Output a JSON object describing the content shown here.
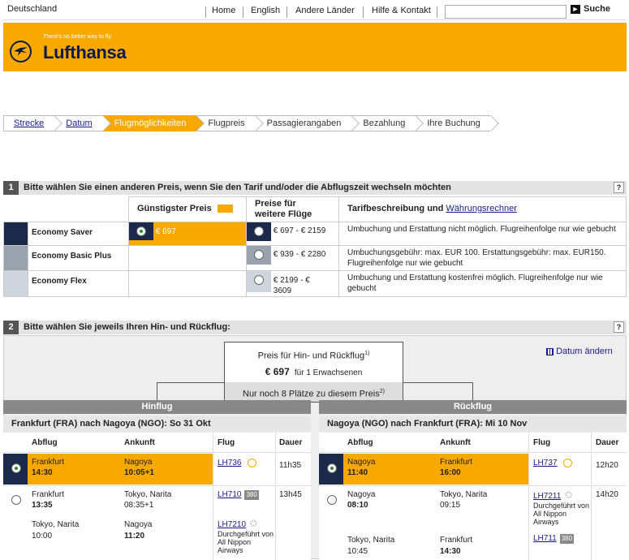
{
  "header": {
    "country": "Deutschland",
    "nav": [
      "Home",
      "English",
      "Andere Länder",
      "Hilfe & Kontakt"
    ],
    "search_label": "Suche",
    "search_value": ""
  },
  "banner": {
    "tagline": "There's no better way to fly.",
    "brand": "Lufthansa"
  },
  "breadcrumb": [
    {
      "label": "Strecke",
      "state": "link"
    },
    {
      "label": "Datum",
      "state": "link"
    },
    {
      "label": "Flugmöglichkeiten",
      "state": "active"
    },
    {
      "label": "Flugpreis",
      "state": "plain"
    },
    {
      "label": "Passagierangaben",
      "state": "plain"
    },
    {
      "label": "Bezahlung",
      "state": "plain"
    },
    {
      "label": "Ihre Buchung",
      "state": "plain"
    }
  ],
  "section1": {
    "number": "1",
    "title": "Bitte wählen Sie einen anderen Preis, wenn Sie den Tarif und/oder die Abflugszeit wechseln möchten",
    "help": "?",
    "col_cheapest": "Günstigster Preis",
    "col_other_line1": "Preise für",
    "col_other_line2": "weitere Flüge",
    "col_desc": "Tarifbeschreibung und",
    "col_desc_link": "Währungsrechner",
    "fares": [
      {
        "name": "Economy Saver",
        "swatch": "#1b2a4a",
        "cheapest": "€ 697",
        "other": "€ 697 - € 2159",
        "desc": "Umbuchung und Erstattung nicht möglich. Flugreihenfolge nur wie gebucht"
      },
      {
        "name": "Economy Basic Plus",
        "swatch": "#9aa3ad",
        "cheapest": "",
        "other": "€ 939 - € 2280",
        "desc": "Umbuchungsgebühr: max. EUR 100. Erstattungsgebühr: max. EUR150. Flugreihenfolge nur wie gebucht"
      },
      {
        "name": "Economy Flex",
        "swatch": "#cfd5dc",
        "cheapest": "",
        "other": "€ 2199 - € 3609",
        "desc": "Umbuchung und Erstattung kostenfrei möglich. Flugreihenfolge nur wie gebucht"
      }
    ]
  },
  "section2": {
    "number": "2",
    "title": "Bitte wählen Sie jeweils Ihren Hin- und Rückflug:",
    "help": "?",
    "price_box_title": "Preis für Hin- und Rückflug",
    "price_box_sup": "1)",
    "price": "€ 697",
    "price_for": "für 1 Erwachsenen",
    "seats_note": "Nur noch 8 Plätze zu diesem Preis",
    "seats_sup": "2)",
    "change_date": "Datum ändern",
    "outbound": {
      "label": "Hinflug",
      "route": "Frankfurt (FRA) nach Nagoya (NGO): So 31 Okt",
      "headers": [
        "Abflug",
        "Ankunft",
        "Flug",
        "Dauer"
      ],
      "options": [
        {
          "selected": true,
          "legs": [
            {
              "dep_city": "Frankfurt",
              "dep_time": "14:30",
              "arr_city": "Nagoya",
              "arr_time": "10:05+1",
              "flight": "LH736",
              "icon": "lufthansa-icon",
              "note": ""
            }
          ],
          "duration": "11h35"
        },
        {
          "selected": false,
          "legs": [
            {
              "dep_city": "Frankfurt",
              "dep_time": "13:35",
              "arr_city": "Tokyo, Narita",
              "arr_time": "08:35+1",
              "flight": "LH710",
              "icon": "aircraft-380-badge",
              "badge": "380",
              "note": ""
            },
            {
              "dep_city": "Tokyo, Narita",
              "dep_time": "10:00",
              "arr_city": "Nagoya",
              "arr_time": "11:20",
              "flight": "LH7210",
              "icon": "star-alliance-icon",
              "note": "Durchgeführt von All Nippon Airways"
            }
          ],
          "duration": "13h45"
        }
      ]
    },
    "inbound": {
      "label": "Rückflug",
      "route": "Nagoya (NGO) nach Frankfurt (FRA): Mi 10 Nov",
      "headers": [
        "Abflug",
        "Ankunft",
        "Flug",
        "Dauer"
      ],
      "options": [
        {
          "selected": true,
          "legs": [
            {
              "dep_city": "Nagoya",
              "dep_time": "11:40",
              "arr_city": "Frankfurt",
              "arr_time": "16:00",
              "flight": "LH737",
              "icon": "lufthansa-icon",
              "note": ""
            }
          ],
          "duration": "12h20"
        },
        {
          "selected": false,
          "legs": [
            {
              "dep_city": "Nagoya",
              "dep_time": "08:10",
              "arr_city": "Tokyo, Narita",
              "arr_time": "09:15",
              "flight": "LH7211",
              "icon": "star-alliance-icon",
              "note": "Durchgeführt von All Nippon Airways"
            },
            {
              "dep_city": "Tokyo, Narita",
              "dep_time": "10:45",
              "arr_city": "Frankfurt",
              "arr_time": "14:30",
              "flight": "LH711",
              "icon": "aircraft-380-badge",
              "badge": "380",
              "note": ""
            }
          ],
          "duration": "14h20"
        }
      ]
    }
  },
  "colors": {
    "brand_yellow": "#f9a800",
    "brand_navy": "#0a1a4a",
    "link": "#1a1a8c"
  }
}
